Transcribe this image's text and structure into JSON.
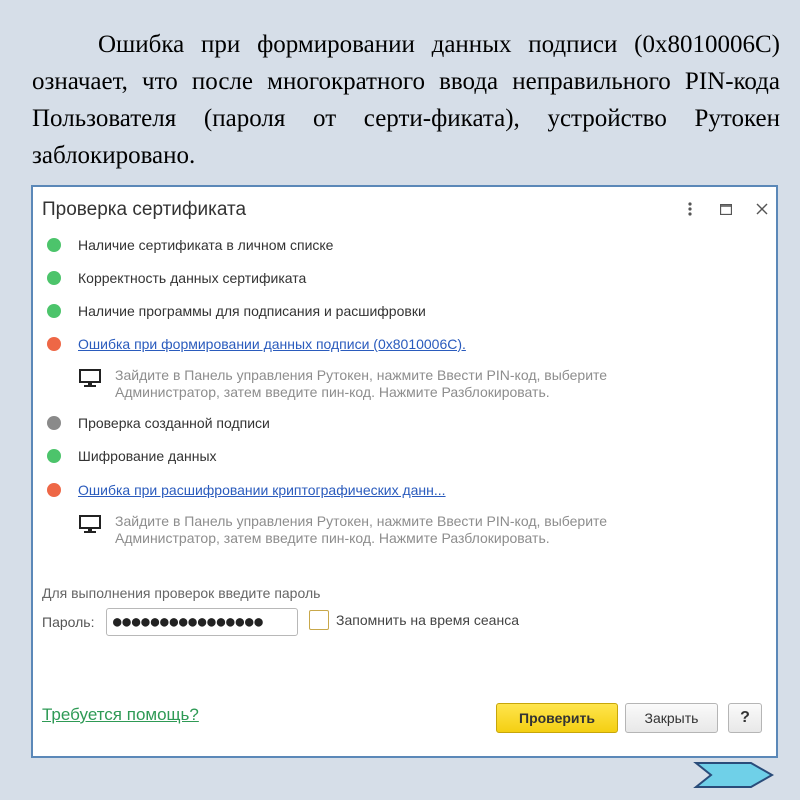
{
  "slide": {
    "text": "Ошибка при формировании данных подписи (0x8010006C) означает, что после многократного ввода неправильного PIN-кода Пользователя (пароля от серти-фиката), устройство Рутокен заблокировано."
  },
  "dialog": {
    "title": "Проверка сертификата",
    "checks": [
      {
        "status": "ok",
        "label": "Наличие сертификата в личном списке"
      },
      {
        "status": "ok",
        "label": "Корректность данных сертификата"
      },
      {
        "status": "ok",
        "label": "Наличие программы для подписания и расшифровки"
      },
      {
        "status": "error",
        "label": "Ошибка при формировании данных подписи (0x8010006C)."
      },
      {
        "status": "skipped",
        "label": "Проверка созданной подписи"
      },
      {
        "status": "ok",
        "label": "Шифрование данных"
      },
      {
        "status": "error",
        "label": "Ошибка при расшифровании криптографических данн..."
      }
    ],
    "hints": [
      "Зайдите в Панель управления Рутокен, нажмите Ввести PIN-код, выберите Администратор, затем введите пин-код. Нажмите Разблокировать.",
      "Зайдите в Панель управления Рутокен, нажмите Ввести PIN-код, выберите Администратор, затем введите пин-код. Нажмите Разблокировать."
    ],
    "password_prompt": "Для выполнения проверок введите пароль",
    "password_label": "Пароль:",
    "password_value": "●●●●●●●●●●●●●●●●",
    "remember_label": "Запомнить на время сеанса",
    "remember_checked": false,
    "help_link": "Требуется помощь?",
    "buttons": {
      "check": "Проверить",
      "close": "Закрыть",
      "help": "?"
    },
    "status_colors": {
      "ok": "#4cc46b",
      "error": "#ee6746",
      "skipped": "#8a8a8a"
    }
  }
}
